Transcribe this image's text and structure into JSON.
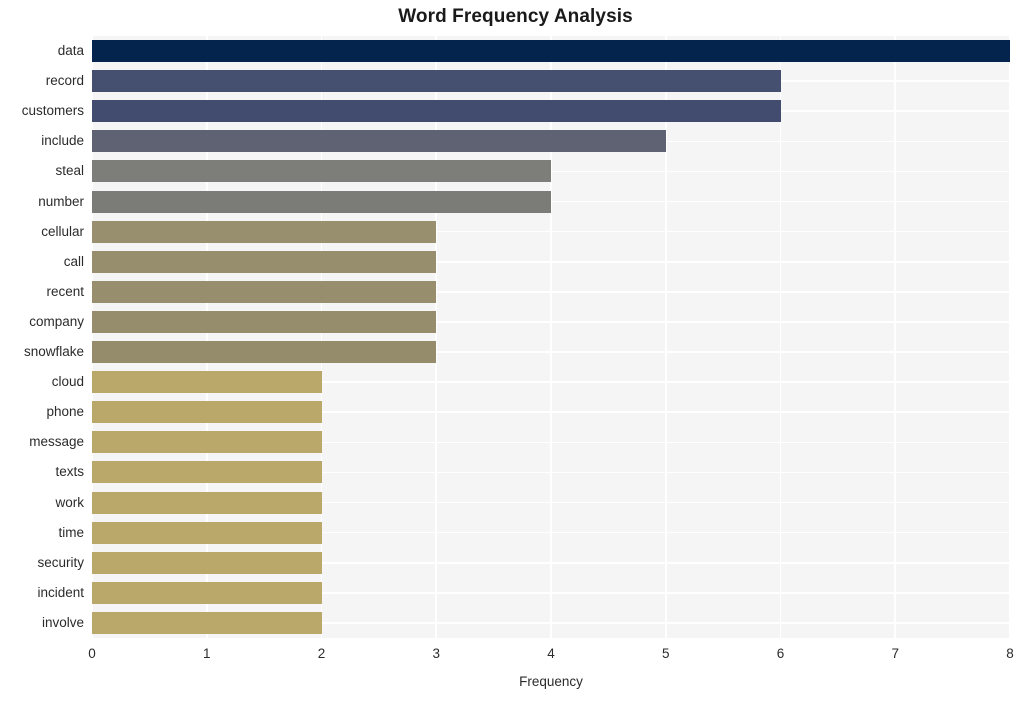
{
  "chart_data": {
    "type": "bar",
    "orientation": "horizontal",
    "title": "Word Frequency Analysis",
    "xlabel": "Frequency",
    "ylabel": "",
    "xlim": [
      0,
      8
    ],
    "xticks": [
      0,
      1,
      2,
      3,
      4,
      5,
      6,
      7,
      8
    ],
    "xtick_labels": [
      "0",
      "1",
      "2",
      "3",
      "4",
      "5",
      "6",
      "7",
      "8"
    ],
    "grid": true,
    "legend": "none",
    "categories": [
      "data",
      "record",
      "customers",
      "include",
      "steal",
      "number",
      "cellular",
      "call",
      "recent",
      "company",
      "snowflake",
      "cloud",
      "phone",
      "message",
      "texts",
      "work",
      "time",
      "security",
      "incident",
      "involve"
    ],
    "values": [
      8,
      6,
      6,
      5,
      4,
      4,
      3,
      3,
      3,
      3,
      3,
      2,
      2,
      2,
      2,
      2,
      2,
      2,
      2,
      2
    ],
    "bar_colors": [
      "#04244d",
      "#454f70",
      "#424c6e",
      "#5e6272",
      "#7d7d79",
      "#7b7b77",
      "#988f6f",
      "#978e6e",
      "#978e6e",
      "#968d6d",
      "#958c6c",
      "#b9a86a",
      "#b9a86a",
      "#b9a86a",
      "#b9a86a",
      "#b9a86a",
      "#b9a86a",
      "#b9a86a",
      "#b9a86a",
      "#b9a86a"
    ],
    "plot_background": "#f5f5f6",
    "grid_color": "#ffffff",
    "text_color": "#2b2b2b"
  }
}
